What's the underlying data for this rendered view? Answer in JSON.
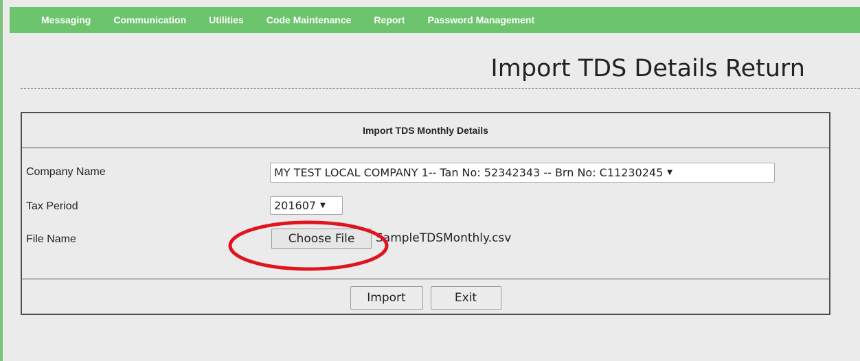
{
  "nav": {
    "items": [
      {
        "label": "Messaging"
      },
      {
        "label": "Communication"
      },
      {
        "label": "Utilities"
      },
      {
        "label": "Code Maintenance"
      },
      {
        "label": "Report"
      },
      {
        "label": "Password Management"
      }
    ]
  },
  "page": {
    "title": "Import TDS Details Return"
  },
  "panel": {
    "header": "Import TDS Monthly Details",
    "company": {
      "label": "Company Name",
      "value": "MY TEST LOCAL COMPANY 1-- Tan No: 52342343 -- Brn No: C11230245"
    },
    "tax_period": {
      "label": "Tax Period",
      "value": "201607"
    },
    "file": {
      "label": "File Name",
      "button": "Choose File",
      "selected": "SampleTDSMonthly.csv"
    },
    "actions": {
      "import": "Import",
      "exit": "Exit"
    }
  },
  "colors": {
    "nav_bg": "#6cc46c",
    "page_bg": "#ebebeb",
    "highlight": "#e0141e"
  },
  "icons": {
    "dropdown": "triangle-down"
  }
}
